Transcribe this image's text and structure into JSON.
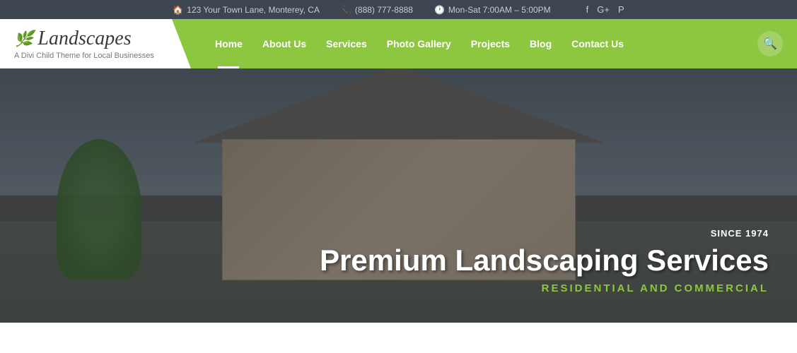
{
  "topbar": {
    "address_icon": "🏠",
    "address": "123 Your Town Lane, Monterey, CA",
    "phone_icon": "📞",
    "phone": "(888) 777-8888",
    "hours_icon": "🕐",
    "hours": "Mon-Sat 7:00AM – 5:00PM",
    "social": {
      "facebook": "f",
      "googleplus": "G+",
      "pinterest": "P"
    }
  },
  "logo": {
    "title": "Landscapes",
    "subtitle": "A Divi Child Theme for Local Businesses"
  },
  "nav": {
    "items": [
      {
        "label": "Home",
        "active": true
      },
      {
        "label": "About Us",
        "active": false
      },
      {
        "label": "Services",
        "active": false
      },
      {
        "label": "Photo Gallery",
        "active": false
      },
      {
        "label": "Projects",
        "active": false
      },
      {
        "label": "Blog",
        "active": false
      },
      {
        "label": "Contact Us",
        "active": false
      }
    ]
  },
  "hero": {
    "since": "SINCE 1974",
    "title": "Premium Landscaping Services",
    "subtitle": "RESIDENTIAL AND COMMERCIAL"
  }
}
